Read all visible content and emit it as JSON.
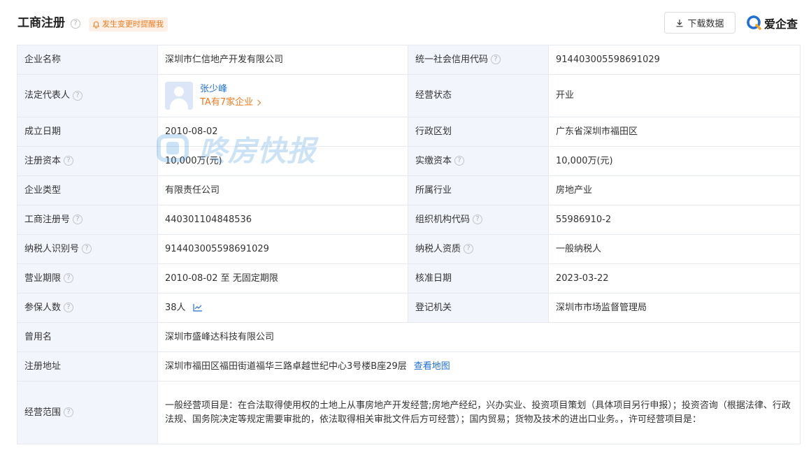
{
  "header": {
    "title": "工商注册",
    "help": "?",
    "alert_label": "发生变更时提醒我",
    "download_label": "下载数据",
    "logo_text": "爱企查"
  },
  "rows": [
    {
      "l1": "企业名称",
      "v1": "深圳市仁信地产开发有限公司",
      "l2": "统一社会信用代码",
      "v2": "914403005598691029"
    },
    {
      "l1": "法定代表人",
      "l2": "经营状态",
      "v2": "开业"
    },
    {
      "l1": "成立日期",
      "v1": "2010-08-02",
      "l2": "行政区划",
      "v2": "广东省深圳市福田区"
    },
    {
      "l1": "注册资本",
      "v1": "10,000万(元)",
      "l2": "实缴资本",
      "v2": "10,000万(元)"
    },
    {
      "l1": "企业类型",
      "v1": "有限责任公司",
      "l2": "所属行业",
      "v2": "房地产业"
    },
    {
      "l1": "工商注册号",
      "v1": "440301104848536",
      "l2": "组织机构代码",
      "v2": "55986910-2"
    },
    {
      "l1": "纳税人识别号",
      "v1": "914403005598691029",
      "l2": "纳税人资质",
      "v2": "一般纳税人"
    },
    {
      "l1": "营业期限",
      "v1": "2010-08-02 至 无固定期限",
      "l2": "核准日期",
      "v2": "2023-03-22"
    },
    {
      "l1": "参保人数",
      "v1": "38人",
      "l2": "登记机关",
      "v2": "深圳市市场监督管理局"
    },
    {
      "l1": "曾用名",
      "v1": "深圳市盛峰达科技有限公司"
    },
    {
      "l1": "注册地址",
      "v1": "深圳市福田区福田街道福华三路卓越世纪中心3号楼B座29层"
    },
    {
      "l1": "经营范围",
      "v1": "一般经营项目是：在合法取得使用权的土地上从事房地产开发经营;房地产经纪，兴办实业、投资项目策划（具体项目另行申报）；投资咨询（根据法律、行政法规、国务院决定等规定需要审批的，依法取得相关审批文件后方可经营）；国内贸易；货物及技术的进出口业务。，许可经营项目是："
    }
  ],
  "legal_rep": {
    "name": "张少峰",
    "link_label": "TA有7家企业"
  },
  "address_map_link": "查看地图",
  "watermark_text": "咚房快报",
  "colors": {
    "accent_blue": "#1f6fd6",
    "accent_orange": "#f07a1e",
    "label_bg": "#f2f6fc",
    "border": "#e6e9ef"
  }
}
